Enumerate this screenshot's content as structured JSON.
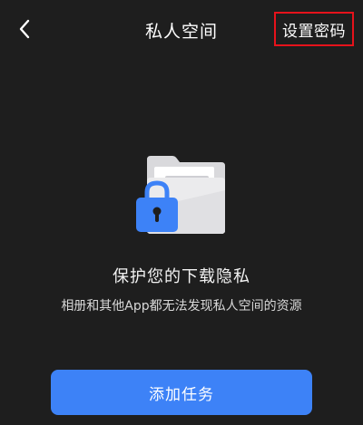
{
  "header": {
    "back_icon": "chevron-left-icon",
    "title": "私人空间",
    "set_password_label": "设置密码",
    "highlight_color": "#e6121b"
  },
  "illustration": {
    "icon": "locked-folder-icon",
    "lock_color": "#3d82f7",
    "folder_color": "#e9e9eb"
  },
  "main": {
    "headline": "保护您的下载隐私",
    "description": "相册和其他App都无法发现私人空间的资源"
  },
  "footer": {
    "add_task_label": "添加任务",
    "button_color": "#3d82f7"
  }
}
